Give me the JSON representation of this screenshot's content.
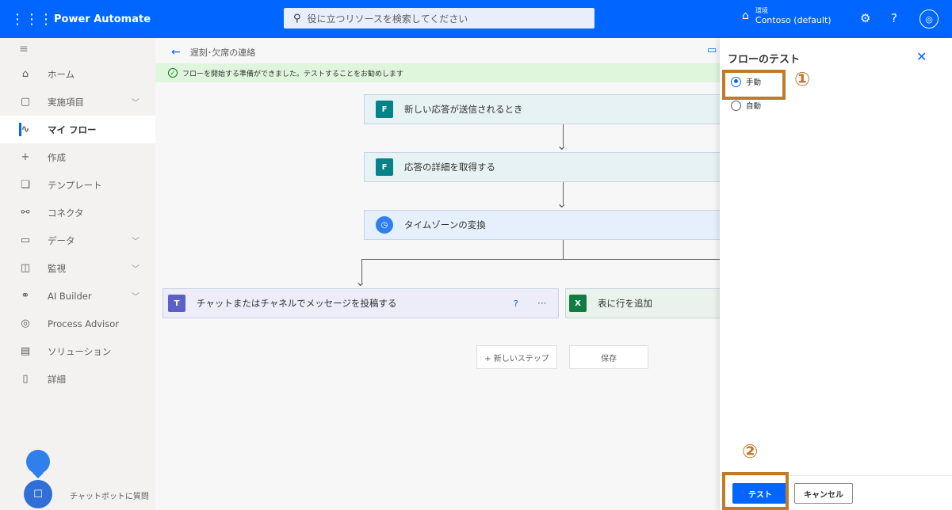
{
  "topbar": {
    "app_name": "Power Automate",
    "search_placeholder": "役に立つリソースを検索してください",
    "env_label": "環境",
    "env_name": "Contoso (default)"
  },
  "nav": {
    "items": [
      {
        "label": "ホーム",
        "icon": "home-icon"
      },
      {
        "label": "実施項目",
        "icon": "clipboard-icon"
      },
      {
        "label": "マイ フロー",
        "icon": "flow-icon"
      },
      {
        "label": "作成",
        "icon": "plus-icon"
      },
      {
        "label": "テンプレート",
        "icon": "template-icon"
      },
      {
        "label": "コネクタ",
        "icon": "connector-icon"
      },
      {
        "label": "データ",
        "icon": "database-icon"
      },
      {
        "label": "監視",
        "icon": "monitor-icon"
      },
      {
        "label": "AI Builder",
        "icon": "ai-icon"
      },
      {
        "label": "Process Advisor",
        "icon": "process-icon"
      },
      {
        "label": "ソリューション",
        "icon": "solution-icon"
      },
      {
        "label": "詳細",
        "icon": "book-icon"
      }
    ],
    "chatbot_label": "チャットボットに質問"
  },
  "canvas": {
    "breadcrumb": "遅刻･欠席の連絡",
    "banner": "フローを開始する準備ができました。テストすることをお勧めします",
    "steps": {
      "s1": "新しい応答が送信されるとき",
      "s2": "応答の詳細を取得する",
      "s3": "タイムゾーンの変換",
      "s4": "チャットまたはチャネルでメッセージを投稿する",
      "s5": "表に行を追加"
    },
    "new_step": "+ 新しいステップ",
    "save": "保存"
  },
  "panel": {
    "title": "フローのテスト",
    "option_manual": "手動",
    "option_auto": "自動",
    "selected": "手動",
    "test_button": "テスト",
    "cancel_button": "キャンセル"
  },
  "annotations": {
    "n1": "①",
    "n2": "②",
    "color": "#c07a2c"
  },
  "colors": {
    "brand": "#0066ff",
    "forms": "#038387",
    "time": "#2f80ed",
    "teams": "#5b5fc7",
    "excel": "#107c41"
  }
}
